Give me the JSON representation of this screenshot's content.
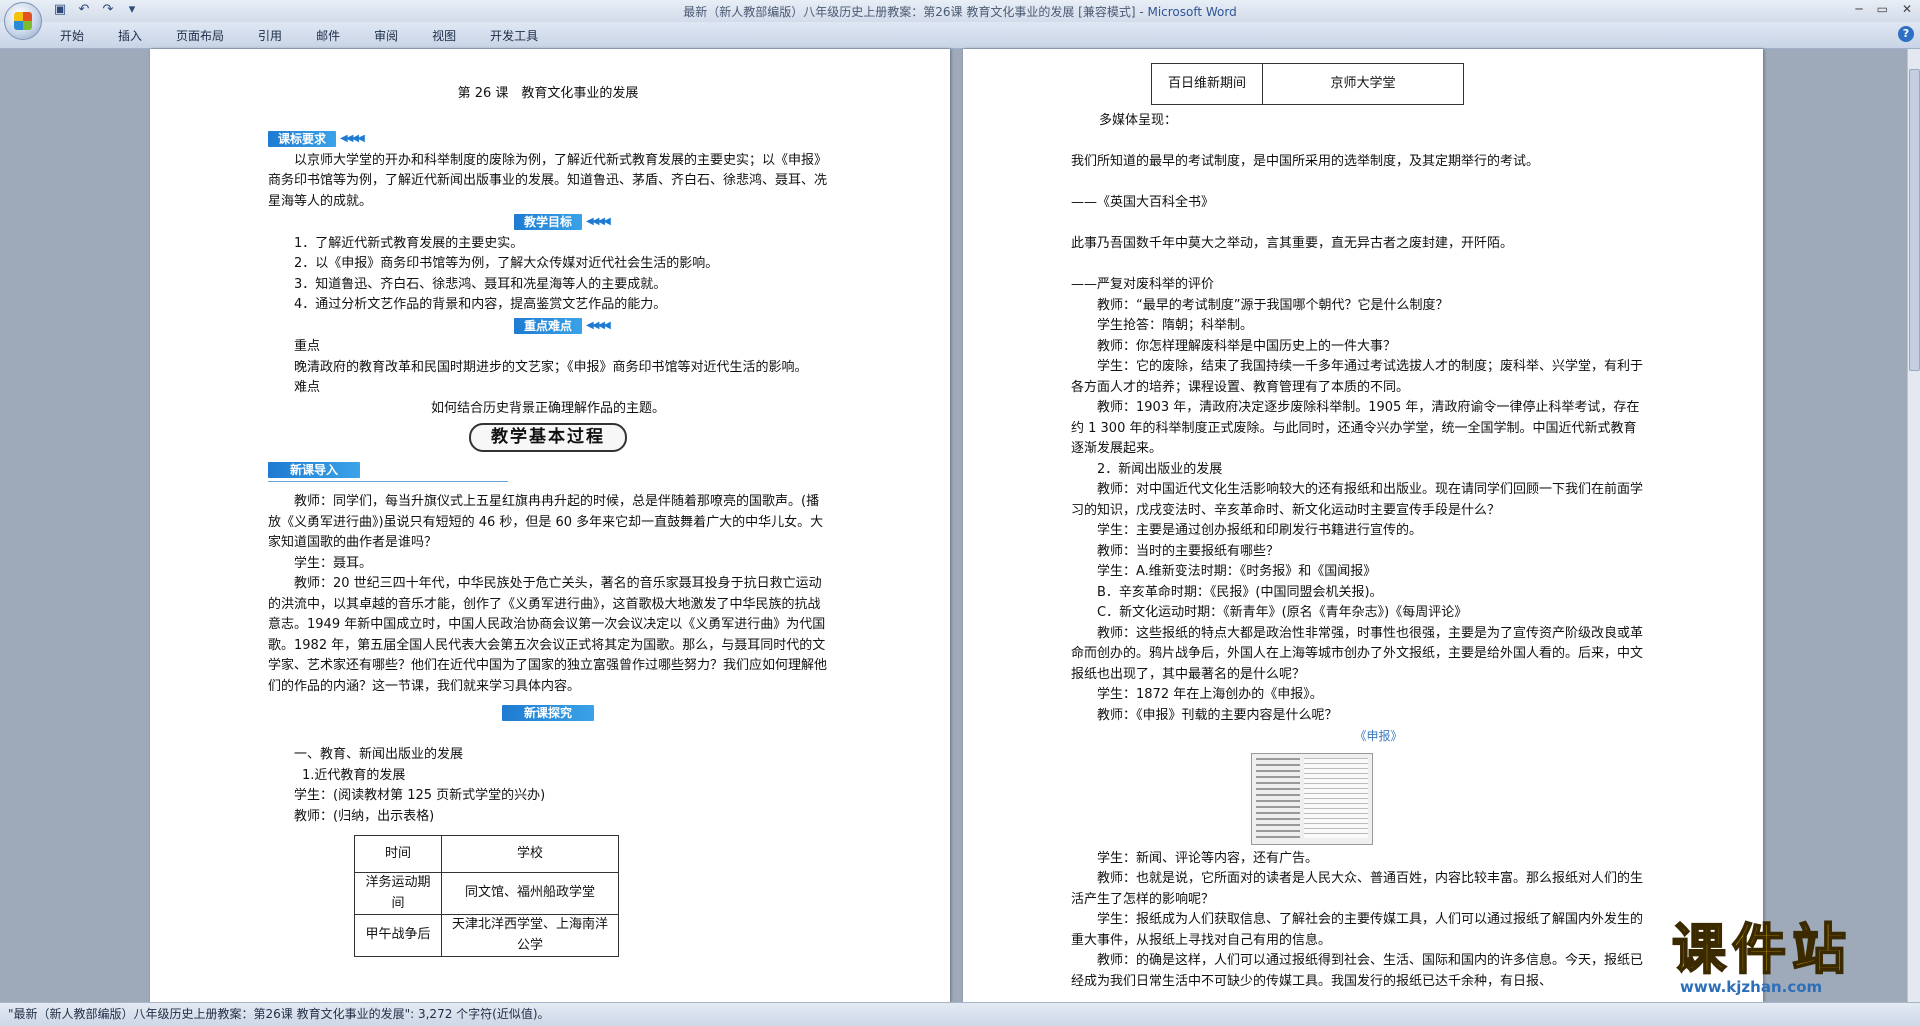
{
  "window": {
    "title": "最新（新人教部编版）八年级历史上册教案：第26课 教育文化事业的发展 [兼容模式]",
    "app_name": "Microsoft Word"
  },
  "ribbon": {
    "tabs": [
      "开始",
      "插入",
      "页面布局",
      "引用",
      "邮件",
      "审阅",
      "视图",
      "开发工具"
    ]
  },
  "left_page": {
    "lesson_title": "第 26 课　教育文化事业的发展",
    "banner_requirements": "课标要求",
    "requirements_text": "以京师大学堂的开办和科举制度的废除为例，了解近代新式教育发展的主要史实；以《申报》商务印书馆等为例，了解近代新闻出版事业的发展。知道鲁迅、茅盾、齐白石、徐悲鸿、聂耳、冼星海等人的成就。",
    "banner_goals": "教学目标",
    "goals": [
      "1．了解近代新式教育发展的主要史实。",
      "2．以《申报》商务印书馆等为例，了解大众传媒对近代社会生活的影响。",
      "3．知道鲁迅、齐白石、徐悲鸿、聂耳和冼星海等人的主要成就。",
      "4．通过分析文艺作品的背景和内容，提高鉴赏文艺作品的能力。"
    ],
    "banner_keypoints": "重点难点",
    "key_label": "重点",
    "key_text": "晚清政府的教育改革和民国时期进步的文艺家；《申报》商务印书馆等对近代生活的影响。",
    "difficult_label": "难点",
    "difficult_text": "如何结合历史背景正确理解作品的主题。",
    "process_title": "教学基本过程",
    "banner_intro": "新课导入",
    "intro_paragraphs": [
      "教师：同学们，每当升旗仪式上五星红旗冉冉升起的时候，总是伴随着那嘹亮的国歌声。(播放《义勇军进行曲》)虽说只有短短的 46 秒，但是 60 多年来它却一直鼓舞着广大的中华儿女。大家知道国歌的曲作者是谁吗？",
      "学生：聂耳。",
      "教师：20 世纪三四十年代，中华民族处于危亡关头，著名的音乐家聂耳投身于抗日救亡运动的洪流中，以其卓越的音乐才能，创作了《义勇军进行曲》，这首歌极大地激发了中华民族的抗战意志。1949 年新中国成立时，中国人民政治协商会议第一次会议决定以《义勇军进行曲》为代国歌。1982 年，第五届全国人民代表大会第五次会议正式将其定为国歌。那么，与聂耳同时代的文学家、艺术家还有哪些？他们在近代中国为了国家的独立富强曾作过哪些努力？我们应如何理解他们的作品的内涵？这一节课，我们就来学习具体内容。"
    ],
    "banner_explore": "新课探究",
    "section_one": "一、教育、新闻出版业的发展",
    "sub_one": "1.近代教育的发展",
    "student_line": "学生：(阅读教材第 125 页新式学堂的兴办)",
    "teacher_line": "教师：(归纳，出示表格)",
    "table": {
      "headers": [
        "时间",
        "学校"
      ],
      "rows": [
        [
          "洋务运动期间",
          "同文馆、福州船政学堂"
        ],
        [
          "甲午战争后",
          "天津北洋西学堂、上海南洋公学"
        ]
      ]
    }
  },
  "right_page": {
    "table_row": [
      "百日维新期间",
      "京师大学堂"
    ],
    "media_label": "多媒体呈现：",
    "quote1": "我们所知道的最早的考试制度，是中国所采用的选举制度，及其定期举行的考试。",
    "quote1_source": "——《英国大百科全书》",
    "quote2": "此事乃吾国数千年中莫大之举动，言其重要，直无异古者之废封建，开阡陌。",
    "quote2_source": "——严复对废科举的评价",
    "dialogue_a": [
      "教师：“最早的考试制度”源于我国哪个朝代？它是什么制度？",
      "学生抢答：隋朝；科举制。",
      "教师：你怎样理解废科举是中国历史上的一件大事？",
      "学生：它的废除，结束了我国持续一千多年通过考试选拔人才的制度；废科举、兴学堂，有利于各方面人才的培养；课程设置、教育管理有了本质的不同。",
      "教师：1903 年，清政府决定逐步废除科举制。1905 年，清政府谕令一律停止科举考试，存在约 1 300 年的科举制度正式废除。与此同时，还通令兴办学堂，统一全国学制。中国近代新式教育逐渐发展起来。",
      "2．新闻出版业的发展",
      "教师：对中国近代文化生活影响较大的还有报纸和出版业。现在请同学们回顾一下我们在前面学习的知识，戊戌变法时、辛亥革命时、新文化运动时主要宣传手段是什么？",
      "学生：主要是通过创办报纸和印刷发行书籍进行宣传的。",
      "教师：当时的主要报纸有哪些？",
      "学生：A.维新变法时期：《时务报》和《国闻报》",
      "B．辛亥革命时期：《民报》(中国同盟会机关报)。",
      "C．新文化运动时期：《新青年》(原名《青年杂志》)《每周评论》",
      "教师：这些报纸的特点大都是政治性非常强，时事性也很强，主要是为了宣传资产阶级改良或革命而创办的。鸦片战争后，外国人在上海等城市创办了外文报纸，主要是给外国人看的。后来，中文报纸也出现了，其中最著名的是什么呢？",
      "学生：1872 年在上海创办的《申报》。",
      "教师：《申报》刊载的主要内容是什么呢？"
    ],
    "newspaper_caption": "《申报》",
    "dialogue_b": [
      "学生：新闻、评论等内容，还有广告。",
      "教师：也就是说，它所面对的读者是人民大众、普通百姓，内容比较丰富。那么报纸对人们的生活产生了怎样的影响呢？",
      "学生：报纸成为人们获取信息、了解社会的主要传媒工具，人们可以通过报纸了解国内外发生的重大事件，从报纸上寻找对自己有用的信息。",
      "教师：的确是这样，人们可以通过报纸得到社会、生活、国际和国内的许多信息。今天，报纸已经成为我们日常生活中不可缺少的传媒工具。我国发行的报纸已达千余种，有日报、"
    ]
  },
  "status_bar": {
    "text": "\"最新（新人教部编版）八年级历史上册教案：第26课 教育文化事业的发展\": 3,272 个字符(近似值)。"
  },
  "watermark": {
    "title": "课件站",
    "url": "www.kjzhan.com"
  }
}
